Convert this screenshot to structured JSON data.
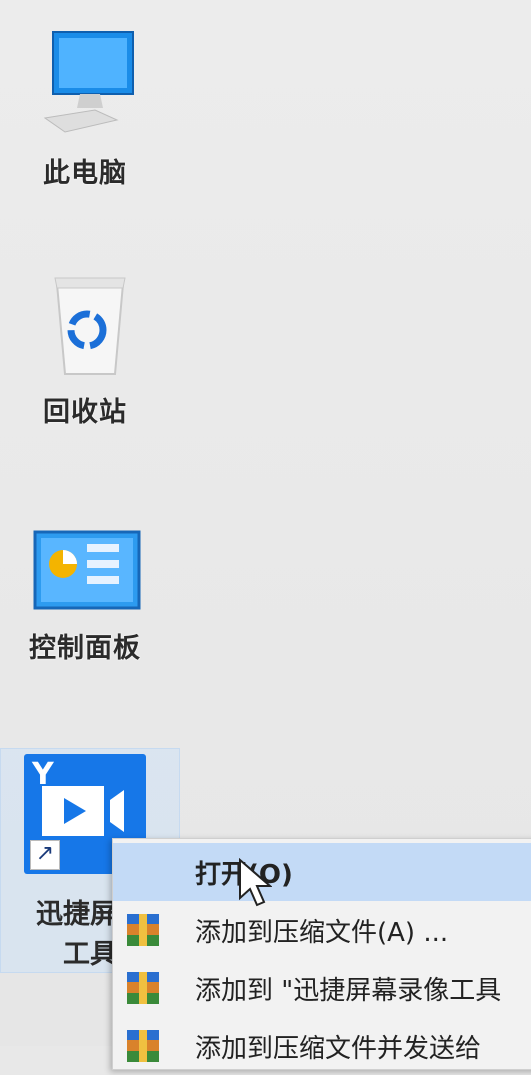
{
  "desktop": {
    "icons": [
      {
        "label": "此电脑",
        "icon": "computer-icon"
      },
      {
        "label": "回收站",
        "icon": "recycle-bin-icon"
      },
      {
        "label": "控制面板",
        "icon": "control-panel-icon"
      }
    ],
    "selected_icon": {
      "label_line1": "迅捷屏幕",
      "label_line2": "工具",
      "icon": "screen-recorder-app-icon"
    }
  },
  "context_menu": {
    "items": [
      {
        "label": "打开(O)",
        "icon": ""
      },
      {
        "label": "添加到压缩文件(A) ...",
        "icon": "winrar-archive-icon"
      },
      {
        "label": "添加到 \"迅捷屏幕录像工具",
        "icon": "winrar-archive-icon"
      },
      {
        "label": "添加到压缩文件并发送给",
        "icon": "winrar-archive-icon"
      }
    ]
  },
  "colors": {
    "desktop_bg": "#e8e8e8",
    "menu_highlight": "#c3daf6",
    "app_tile": "#1677e8"
  }
}
